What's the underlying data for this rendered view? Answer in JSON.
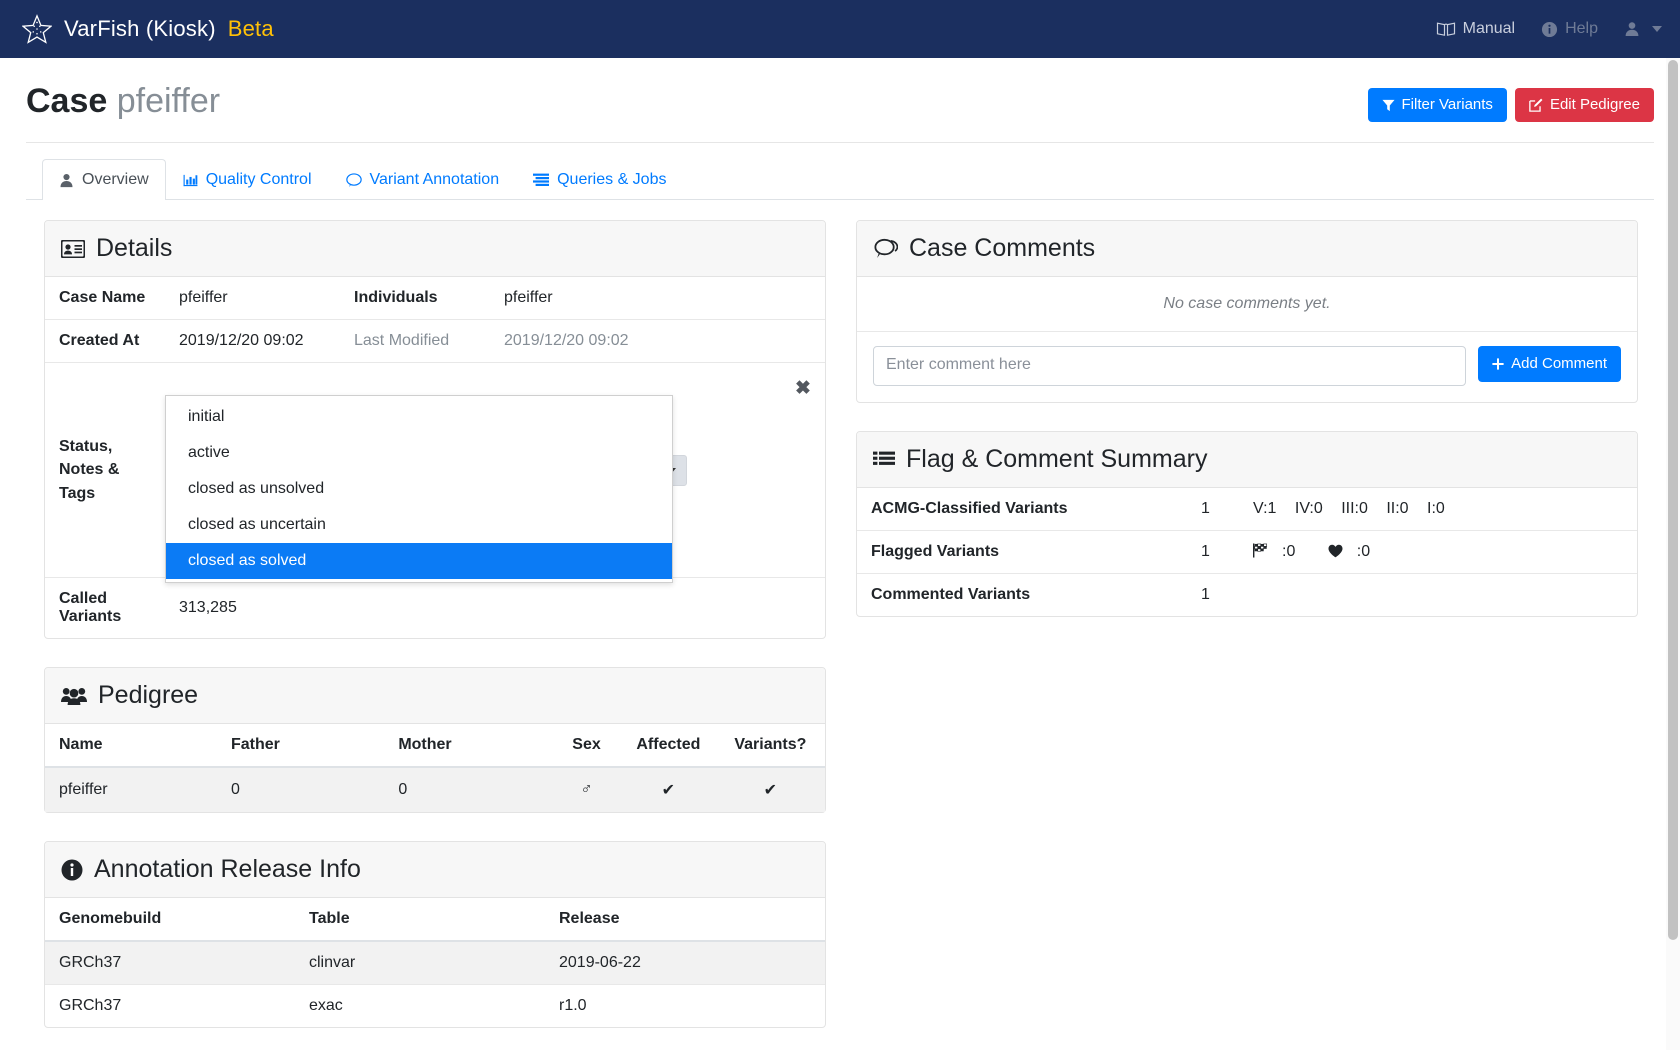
{
  "navbar": {
    "logo_icon": "starfish-icon",
    "brand": "VarFish (Kiosk)",
    "beta": "Beta",
    "links": [
      {
        "label": "Manual",
        "icon": "book-open-icon"
      },
      {
        "label": "Help",
        "icon": "info-circle-icon"
      }
    ],
    "user_icon": "user-icon",
    "caret_icon": "chevron-down-icon"
  },
  "header": {
    "title": "Case",
    "subtitle": "pfeiffer",
    "buttons": [
      {
        "label": "Filter Variants",
        "icon": "filter-icon",
        "color": "#007bff"
      },
      {
        "label": "Edit Pedigree",
        "icon": "edit-icon",
        "color": "#dc3545"
      }
    ]
  },
  "tabs": [
    {
      "label": "Overview",
      "icon": "user-icon",
      "active": true
    },
    {
      "label": "Quality Control",
      "icon": "chart-bar-icon",
      "active": false
    },
    {
      "label": "Variant Annotation",
      "icon": "comment-icon",
      "active": false
    },
    {
      "label": "Queries & Jobs",
      "icon": "list-stream-icon",
      "active": false
    }
  ],
  "details": {
    "title": "Details",
    "icon": "id-card-icon",
    "case_name_label": "Case Name",
    "case_name_value": "pfeiffer",
    "individuals_label": "Individuals",
    "individuals_value": "pfeiffer",
    "created_at_label": "Created At",
    "created_at_value": "2019/12/20 09:02",
    "last_modified_label": "Last Modified",
    "last_modified_value": "2019/12/20 09:02",
    "status_label": "Status, Notes & Tags",
    "status_select": {
      "value": "initial",
      "options": [
        {
          "label": "initial",
          "selected": false
        },
        {
          "label": "active",
          "selected": false
        },
        {
          "label": "closed as unsolved",
          "selected": false
        },
        {
          "label": "closed as uncertain",
          "selected": false
        },
        {
          "label": "closed as solved",
          "selected": true
        }
      ],
      "highlight_color": "#0b7bf5"
    },
    "clear_icon": "close-x-icon",
    "called_variants_label": "Called Variants",
    "called_variants_value": "313,285"
  },
  "case_comments": {
    "title": "Case Comments",
    "icon": "comments-icon",
    "empty_text": "No case comments yet.",
    "input_value": "",
    "input_placeholder": "Enter comment here",
    "add_button": "Add Comment",
    "add_button_icon": "plus-icon"
  },
  "flag_summary": {
    "title": "Flag & Comment Summary",
    "icon": "list-icon",
    "rows": [
      {
        "label": "ACMG-Classified Variants",
        "count": "1",
        "details": [
          "V:1",
          "IV:0",
          "III:0",
          "II:0",
          "I:0"
        ],
        "icons": []
      },
      {
        "label": "Flagged Variants",
        "count": "1",
        "details": [],
        "icons": [
          {
            "name": "checkered-flag-icon",
            "value": ":0"
          },
          {
            "name": "heart-icon",
            "value": ":0"
          }
        ]
      },
      {
        "label": "Commented Variants",
        "count": "1",
        "details": [],
        "icons": []
      }
    ]
  },
  "pedigree": {
    "title": "Pedigree",
    "icon": "users-icon",
    "columns": [
      "Name",
      "Father",
      "Mother",
      "Sex",
      "Affected",
      "Variants?"
    ],
    "rows": [
      {
        "name": "pfeiffer",
        "father": "0",
        "mother": "0",
        "sex": "♂",
        "sex_icon": "mars-male-icon",
        "affected": "✔",
        "affected_icon": "check-icon",
        "variants": "✔",
        "variants_icon": "check-icon"
      }
    ]
  },
  "annotation_release": {
    "title": "Annotation Release Info",
    "icon": "info-circle-icon",
    "columns": [
      "Genomebuild",
      "Table",
      "Release"
    ],
    "rows": [
      {
        "genomebuild": "GRCh37",
        "table": "clinvar",
        "release": "2019-06-22"
      },
      {
        "genomebuild": "GRCh37",
        "table": "exac",
        "release": "r1.0"
      }
    ]
  },
  "colors": {
    "navbar": "#1b2f5f",
    "accent_blue": "#007bff",
    "danger_red": "#dc3545",
    "beta_yellow": "#ffc107"
  }
}
